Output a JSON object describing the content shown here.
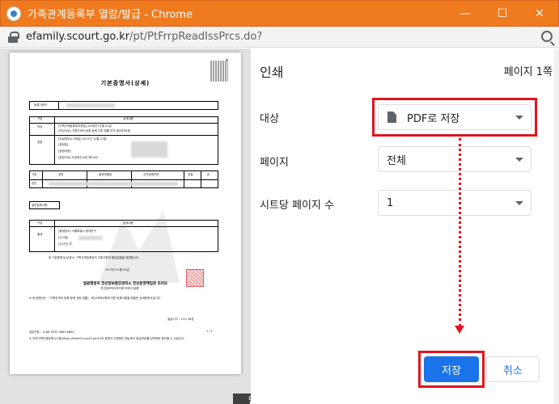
{
  "window": {
    "title": "가족관계등록부 열람/발급 - Chrome",
    "minimize": "—",
    "maximize": "☐",
    "close": "✕"
  },
  "address": {
    "host": "efamily.scourt.go.kr",
    "path": "/pt/PtFrrpReadIssPrcs.do?"
  },
  "document": {
    "title": "기본증명서(상세)",
    "rows": [
      "등록기준지",
      "구분",
      "상세내용",
      "작성",
      "[가족관계등록부작성일] 2008년 01월 01일",
      "[작성사유] 가족관계의 등록 등에 관한 법률 부칙 제3조제1항",
      "정정",
      "[도로명주소기재일] 2011년 12월 12일",
      "[정정일]",
      "[정정내용]",
      "[정정사유] 도로명주소법 제2025",
      "구분",
      "성명",
      "출생연월일",
      "주민등록번호",
      "성별",
      "본",
      "본인",
      "일반등록사항",
      "구분",
      "상세내용",
      "출생",
      "[출생장소] 서울특별시 동대문구",
      "[신고일]",
      "[신고인] 부",
      "위 기본증명서(상세)는 가족관계등록부의 기록사항과 틀림없음을 증명합니다.",
      "2023년 01월 04일",
      "전산정보처리조직에 의하여 발행",
      "※ 위 증명서는 「가족관계의 등록 등에 관한 법률」 제15조제2항에 따른 등록사항을 현출한 상세증명서입니다.",
      "발급시각 : 13시 38분",
      "발급번호 : 1188-3932-3883-8884",
      "※ 전자가족관계등록시스템(https://efamily.scourt.go.kr)의 증명서 진위확인 메뉴에서 발급번호를 입력하여 확인할 수 있습니다.",
      "1 / 1"
    ],
    "cert_line": "법원행정처 전산정보중앙관리소 전산운영책임관 조리오",
    "bottom_strip": "닫기"
  },
  "panel": {
    "title": "인쇄",
    "page_count": "페이지 1쪽",
    "destination_label": "대상",
    "destination_value": "PDF로 저장",
    "pages_label": "페이지",
    "pages_value": "전체",
    "pages_per_sheet_label": "시트당 페이지 수",
    "pages_per_sheet_value": "1",
    "save_button": "저장",
    "cancel_button": "취소"
  },
  "colors": {
    "titlebar": "#f07a1e",
    "highlight": "#e0141e",
    "primary": "#1a73e8"
  }
}
